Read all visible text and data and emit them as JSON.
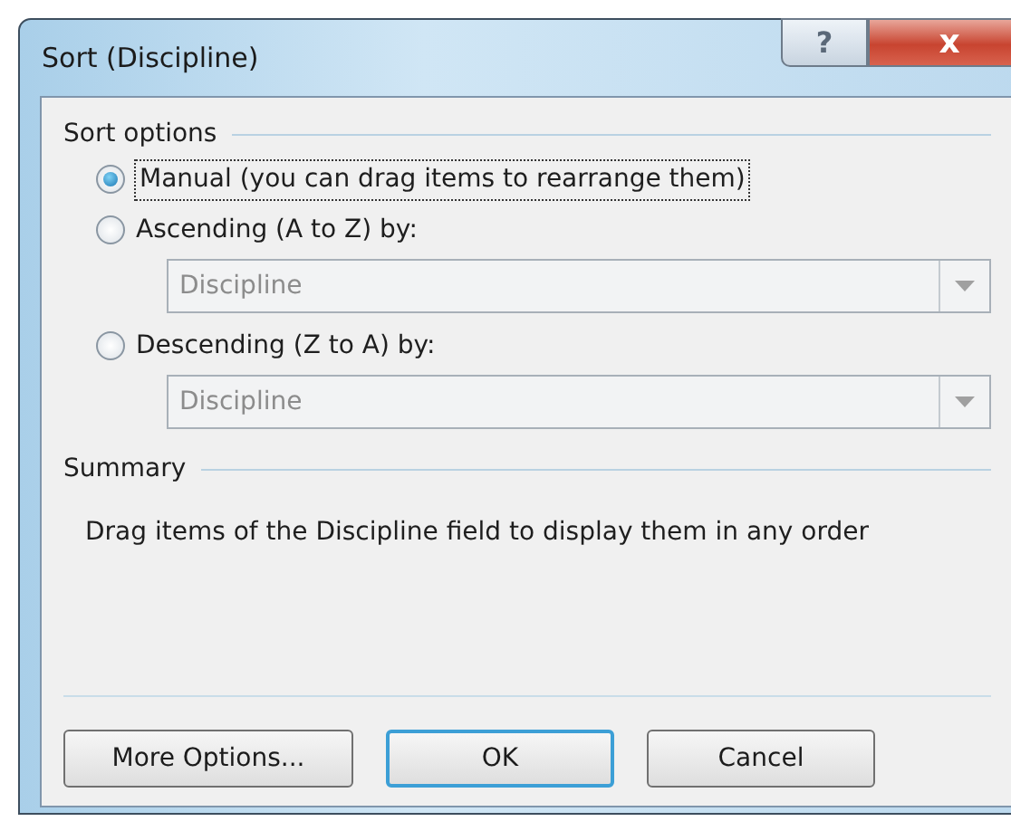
{
  "window": {
    "title": "Sort (Discipline)",
    "help_button": "?",
    "close_button": "x"
  },
  "sort_options": {
    "heading": "Sort options",
    "options": [
      {
        "kind": "radio",
        "label": "Manual (you can drag items to rearrange them)",
        "selected": true
      },
      {
        "kind": "radio",
        "label": "Ascending (A to Z) by:",
        "selected": false
      },
      {
        "kind": "combo",
        "value": "Discipline",
        "disabled": true
      },
      {
        "kind": "radio",
        "label": "Descending (Z to A) by:",
        "selected": false
      },
      {
        "kind": "combo",
        "value": "Discipline",
        "disabled": true
      }
    ]
  },
  "summary": {
    "heading": "Summary",
    "text": "Drag items of the Discipline field to display them in any order"
  },
  "buttons": [
    {
      "label": "More Options...",
      "default": false
    },
    {
      "label": "OK",
      "default": true
    },
    {
      "label": "Cancel",
      "default": false
    }
  ]
}
